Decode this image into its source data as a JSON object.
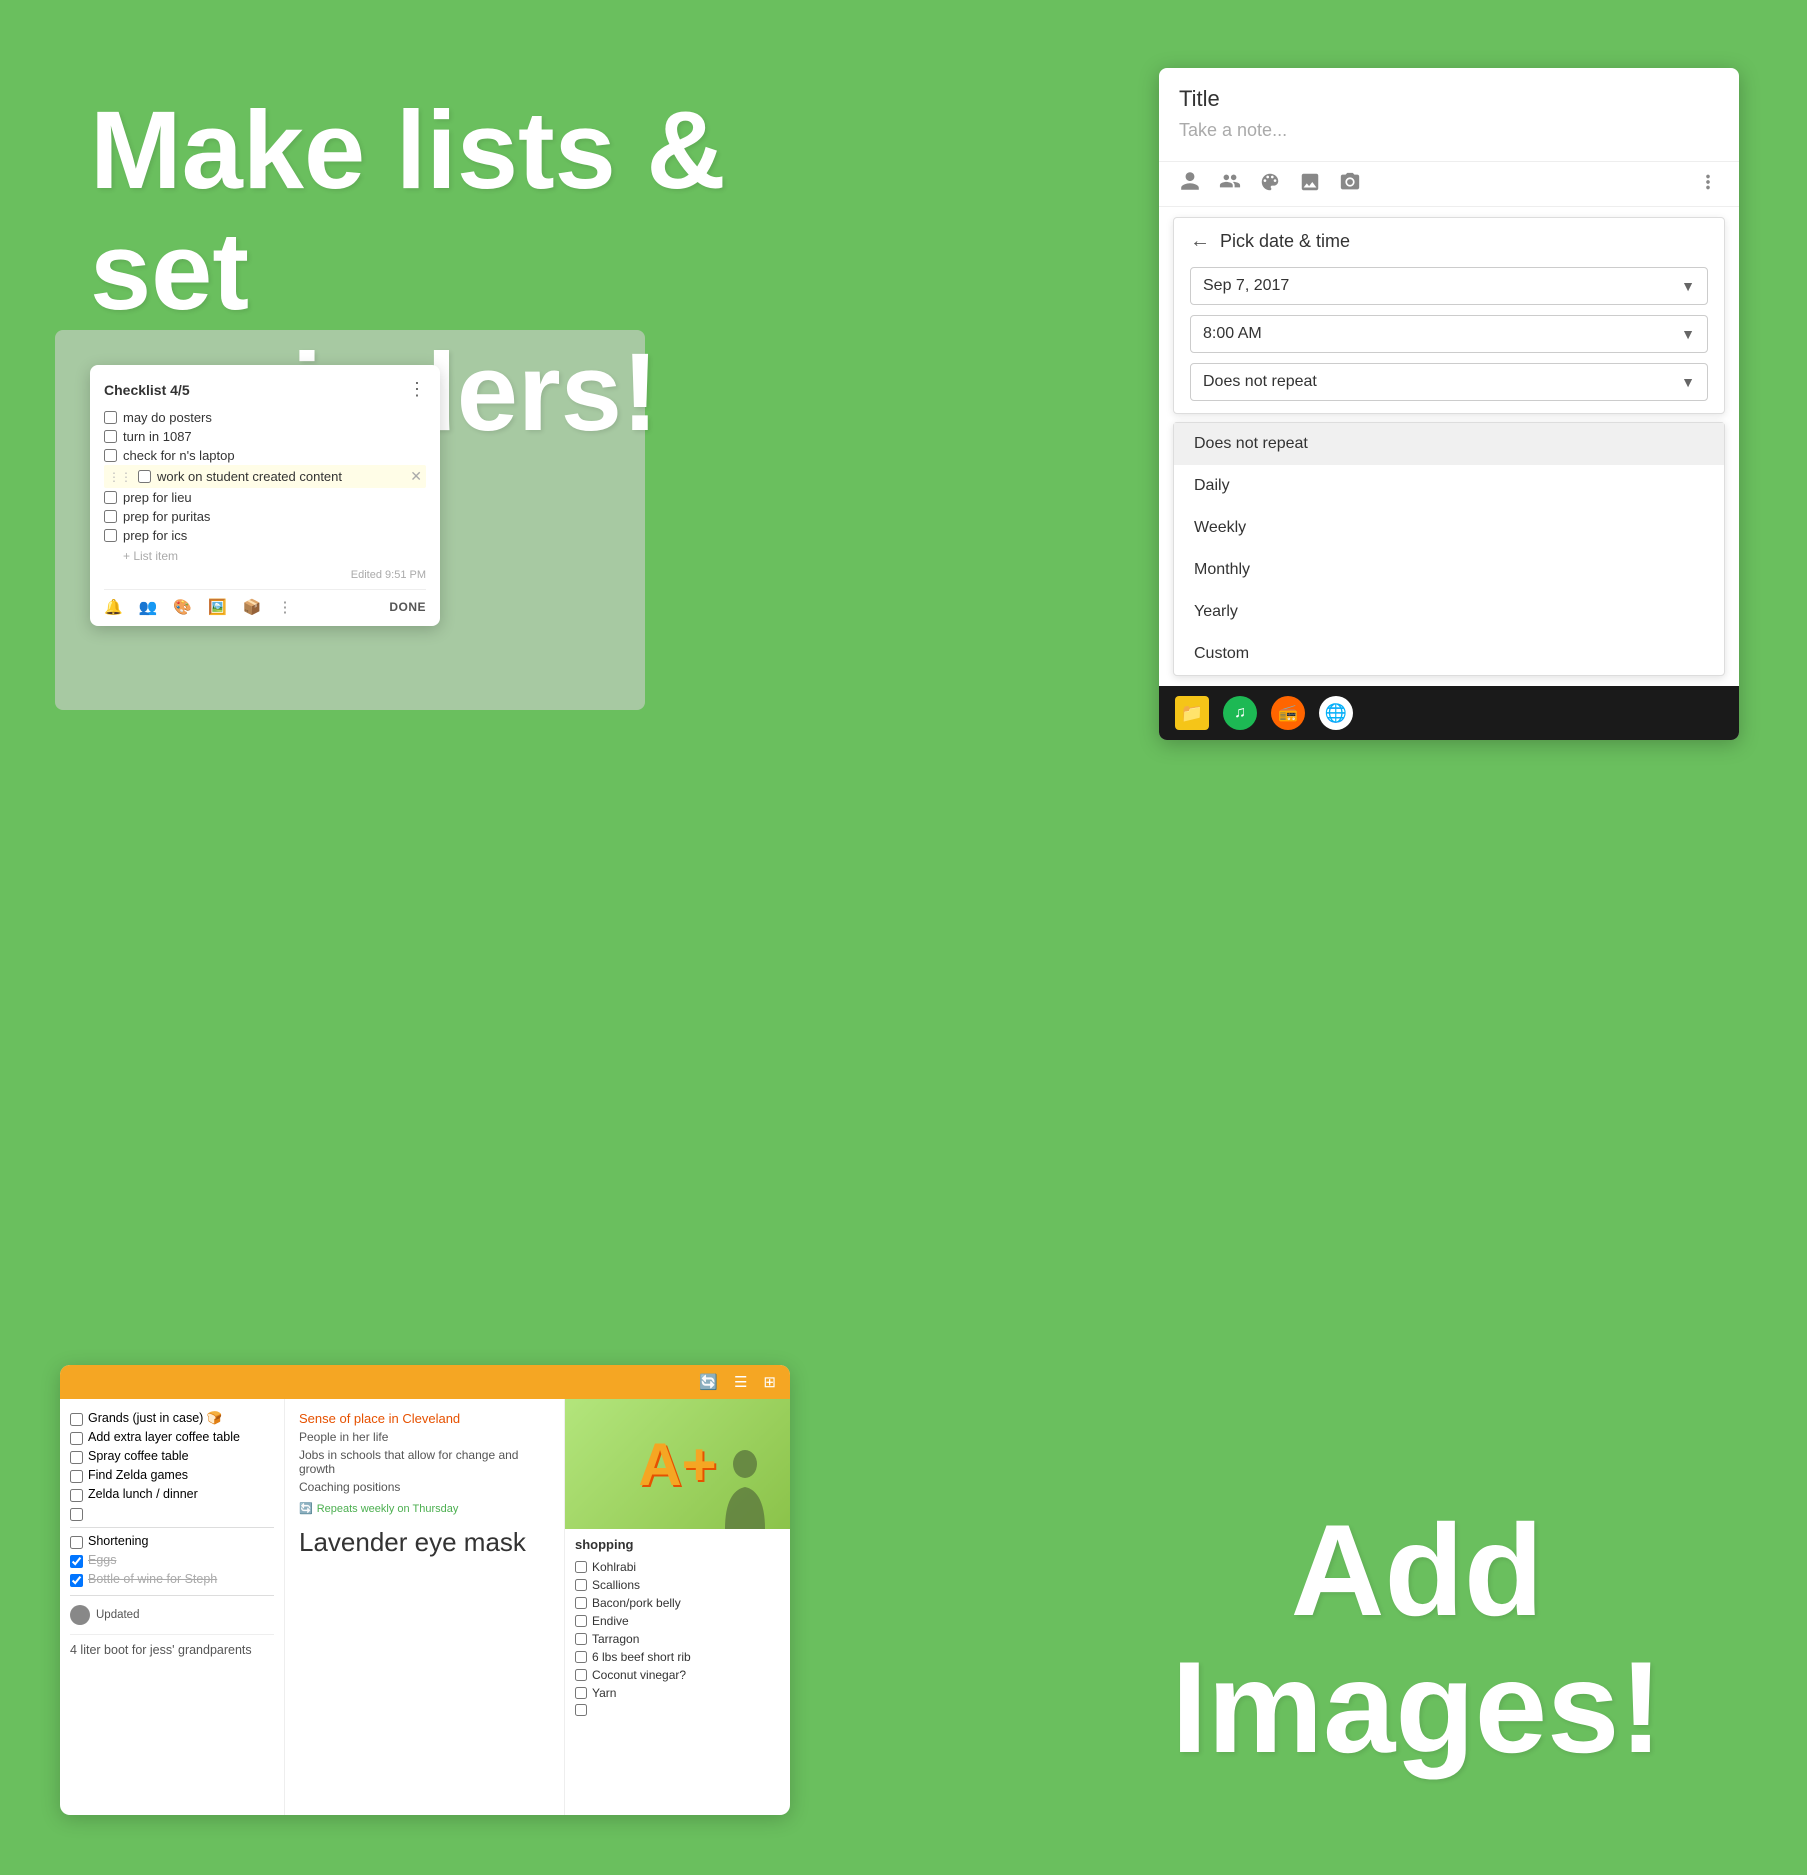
{
  "background_color": "#6abf5e",
  "headline": {
    "line1": "Make lists &",
    "line2": "set reminders!"
  },
  "add_images": {
    "line1": "Add",
    "line2": "Images!"
  },
  "reminder_panel": {
    "title": "Title",
    "note_placeholder": "Take a note...",
    "icons": [
      "person-icon",
      "people-icon",
      "palette-icon",
      "image-icon",
      "camera-icon",
      "more-icon"
    ],
    "pick_datetime": {
      "label": "Pick date & time",
      "date": "Sep 7, 2017",
      "time": "8:00 AM",
      "repeat": "Does not repeat"
    },
    "repeat_options": [
      {
        "label": "Does not repeat",
        "selected": true
      },
      {
        "label": "Daily",
        "selected": false
      },
      {
        "label": "Weekly",
        "selected": false
      },
      {
        "label": "Monthly",
        "selected": false
      },
      {
        "label": "Yearly",
        "selected": false
      },
      {
        "label": "Custom",
        "selected": false
      }
    ],
    "taskbar_icons": [
      "files-icon",
      "spotify-icon",
      "podcast-icon",
      "chrome-icon"
    ]
  },
  "checklist_panel": {
    "title": "Checklist 4/5",
    "items": [
      {
        "text": "may do posters",
        "checked": false
      },
      {
        "text": "turn in 1087",
        "checked": false
      },
      {
        "text": "check for n's laptop",
        "checked": false
      },
      {
        "text": "work on student created content",
        "checked": false,
        "active": true
      },
      {
        "text": "prep for lieu",
        "checked": false
      },
      {
        "text": "prep for puritas",
        "checked": false
      },
      {
        "text": "prep for ics",
        "checked": false
      }
    ],
    "add_item_label": "+ List item",
    "edited_text": "Edited 9:51 PM",
    "done_label": "DONE"
  },
  "shopping_panel": {
    "checklist_items_left": [
      {
        "text": "Grands (just in case) 🍞",
        "checked": false
      },
      {
        "text": "Add extra layer coffee table",
        "checked": false
      },
      {
        "text": "Spray coffee table",
        "checked": false
      },
      {
        "text": "Find Zelda games",
        "checked": false
      },
      {
        "text": "Zelda lunch / dinner",
        "checked": false
      },
      {
        "text": "Shortening",
        "checked": false
      },
      {
        "text": "Eggs",
        "checked": true,
        "strikethrough": true
      },
      {
        "text": "Bottle of wine for Steph",
        "checked": true,
        "strikethrough": true
      }
    ],
    "updated_by": "Updated",
    "bottom_note": "4 liter boot for jess' grandparents",
    "middle_note": {
      "title": "Lavender eye mask",
      "sense_title": "Sense of place in Cleveland",
      "sense_desc1": "People in her life",
      "sense_desc2": "Jobs in schools that allow for change and growth",
      "sense_desc3": "Coaching positions",
      "repeats": "Repeats weekly on Thursday"
    },
    "right_col": {
      "grade_letter": "A+",
      "shopping_label": "shopping",
      "items": [
        {
          "text": "Kohlrabi",
          "checked": false
        },
        {
          "text": "Scallions",
          "checked": false
        },
        {
          "text": "Bacon/pork belly",
          "checked": false
        },
        {
          "text": "Endive",
          "checked": false
        },
        {
          "text": "Tarragon",
          "checked": false
        },
        {
          "text": "6 lbs beef short rib",
          "checked": false
        },
        {
          "text": "Coconut vinegar?",
          "checked": false
        },
        {
          "text": "Yarn",
          "checked": false
        }
      ]
    }
  }
}
